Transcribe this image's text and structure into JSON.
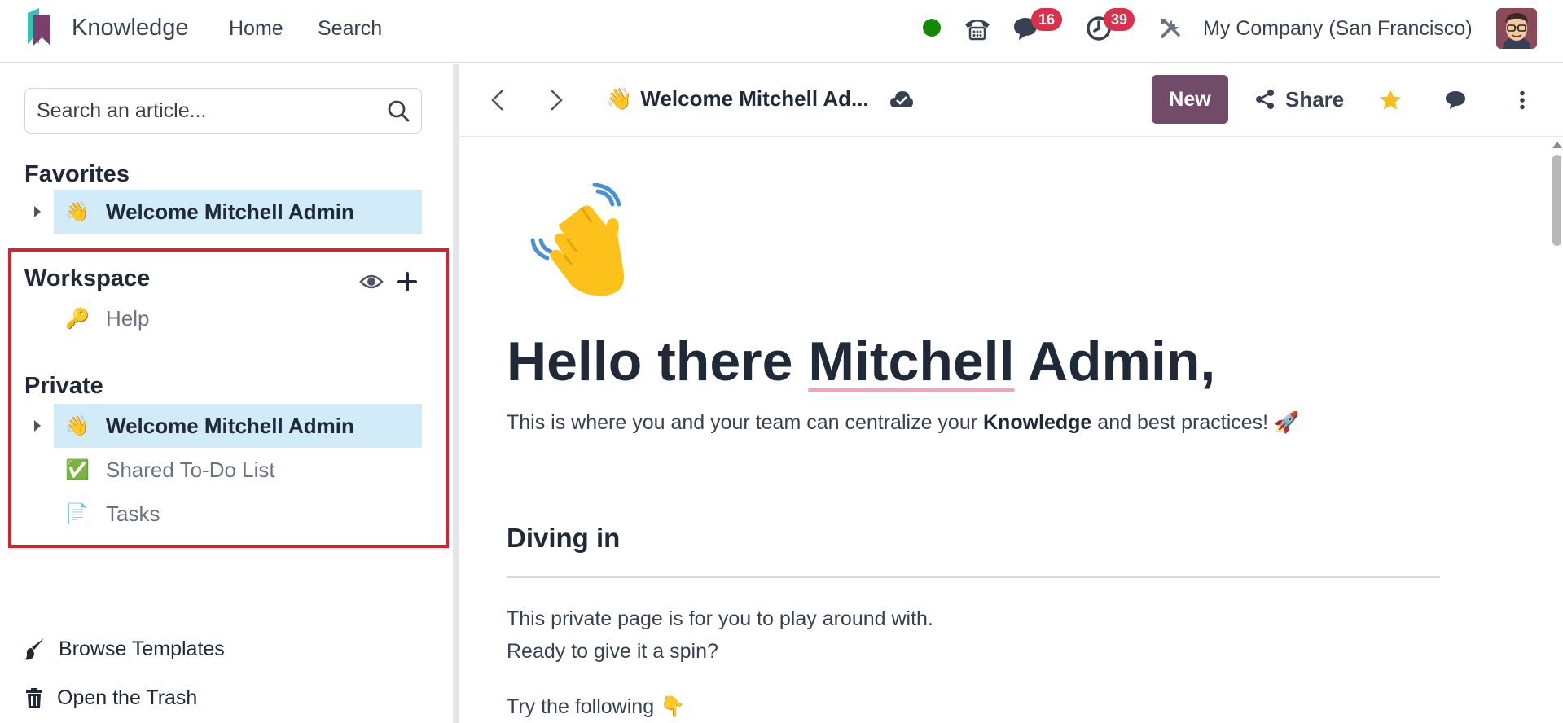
{
  "topbar": {
    "app_name": "Knowledge",
    "nav": [
      "Home",
      "Search"
    ],
    "messages_count": "16",
    "activities_count": "39",
    "company": "My Company (San Francisco)"
  },
  "sidebar": {
    "search_placeholder": "Search an article...",
    "favorites": {
      "title": "Favorites",
      "items": [
        {
          "emoji": "👋",
          "label": "Welcome Mitchell Admin"
        }
      ]
    },
    "workspace": {
      "title": "Workspace",
      "items": [
        {
          "emoji": "🔑",
          "label": "Help"
        }
      ]
    },
    "private": {
      "title": "Private",
      "items": [
        {
          "emoji": "👋",
          "label": "Welcome Mitchell Admin"
        },
        {
          "emoji": "✅",
          "label": "Shared To-Do List"
        },
        {
          "emoji": "📄",
          "label": "Tasks"
        }
      ]
    },
    "footer": {
      "browse_templates": "Browse Templates",
      "open_trash": "Open the Trash"
    }
  },
  "toolbar": {
    "breadcrumb_emoji": "👋",
    "breadcrumb": "Welcome Mitchell Ad...",
    "new_label": "New",
    "share_label": "Share"
  },
  "article": {
    "icon_emoji": "👋",
    "title_part1": "Hello there ",
    "title_part2": "Mitchell",
    "title_part3": " Admin,",
    "intro_part1": "This is where you and your team can centralize your ",
    "intro_bold": "Knowledge",
    "intro_part2": " and best practices! 🚀",
    "heading": "Diving in",
    "para1": "This private page is for you to play around with.",
    "para2": "Ready to give it a spin?",
    "para3": "Try the following 👇"
  },
  "colors": {
    "brand": "#714b67",
    "active_row": "#d1ebf8",
    "highlight_border": "#d2232e",
    "badge": "#dc2f4b",
    "online": "#138a07",
    "favorite_star": "#f3c01c"
  }
}
